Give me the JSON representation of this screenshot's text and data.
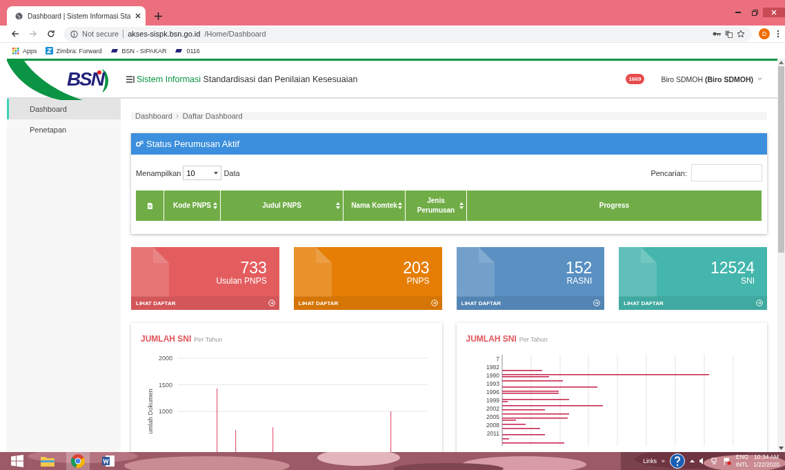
{
  "browser": {
    "tab_title": "Dashboard | Sistem Informasi Sta",
    "url_note": "Not secure",
    "url_host": "akses-sispk.bsn.go.id",
    "url_path": "/Home/Dashboard",
    "avatar": "D",
    "bookmarks": [
      {
        "label": "Apps",
        "kind": "apps"
      },
      {
        "label": "Zimbra: Forward",
        "kind": "zimbra"
      },
      {
        "label": "BSN - SIPAKAR",
        "kind": "bsn"
      },
      {
        "label": "0116",
        "kind": "bsn"
      }
    ]
  },
  "header": {
    "logo": "BSN",
    "title_accent": "Sistem Informasi",
    "title_rest": "Standardisasi dan Penilaian Kesesuaian",
    "badge": "1669",
    "user": "Biro SDMOH **(Biro SDMOH)**"
  },
  "sidebar": {
    "items": [
      {
        "label": "Dashboard",
        "selected": true
      },
      {
        "label": "Penetapan",
        "selected": false
      }
    ]
  },
  "breadcrumb": [
    "Dashboard",
    "Daftar Dashboard"
  ],
  "status_panel": {
    "title": "Status Perumusan Aktif",
    "show_label": "Menampilkan",
    "page_size": "10",
    "show_suffix": "Data",
    "search_label": "Pencarian:",
    "columns": [
      {
        "kind": "icon",
        "sortable": false
      },
      {
        "label": "Kode PNPS",
        "kind": "text",
        "sortable": true
      },
      {
        "label": "Judul PNPS",
        "kind": "text",
        "sortable": true
      },
      {
        "label": "Nama Komtek",
        "kind": "text",
        "sortable": true
      },
      {
        "label": "Jenis Perumusan",
        "kind": "text",
        "sortable": true
      },
      {
        "label": "Progress",
        "kind": "text",
        "sortable": false
      }
    ]
  },
  "stat_cards": [
    {
      "value": "733",
      "label": "Usulan PNPS",
      "link": "LIHAT DAFTAR",
      "color": "#e35d5f"
    },
    {
      "value": "203",
      "label": "PNPS",
      "link": "LIHAT DAFTAR",
      "color": "#e67e06"
    },
    {
      "value": "152",
      "label": "RASNI",
      "link": "LIHAT DAFTAR",
      "color": "#5a90c2"
    },
    {
      "value": "12524",
      "label": "SNI",
      "link": "LIHAT DAFTAR",
      "color": "#45b6ad"
    }
  ],
  "charts": [
    {
      "title": "JUMLAH SNI",
      "subtitle": "Per Tahun",
      "kind": "column",
      "chart_data": {
        "type": "bar",
        "ylabel": "umlah Dokumen",
        "ylim": [
          0,
          2000
        ],
        "yticks": [
          1000,
          1500,
          2000
        ],
        "values": [
          null,
          null,
          null,
          null,
          null,
          null,
          1430,
          null,
          null,
          650,
          null,
          null,
          null,
          null,
          null,
          700,
          null,
          null,
          null,
          null,
          null,
          null,
          null,
          null,
          null,
          null,
          null,
          null,
          null,
          null,
          null,
          null,
          null,
          null,
          1000,
          null,
          null,
          null,
          null,
          null
        ]
      }
    },
    {
      "title": "JUMLAH SNI",
      "subtitle": "Per Tahun",
      "kind": "horizontal",
      "year_labels": [
        "7",
        "1982",
        "1990",
        "1993",
        "1996",
        "1999",
        "2002",
        "2005",
        "2008",
        "2011"
      ]
    }
  ],
  "taskbar": {
    "links": "Links",
    "more": "»",
    "lang_top": "ENG",
    "lang_bottom": "INTL",
    "time": "10:34 AM",
    "date": "1/22/2020"
  }
}
